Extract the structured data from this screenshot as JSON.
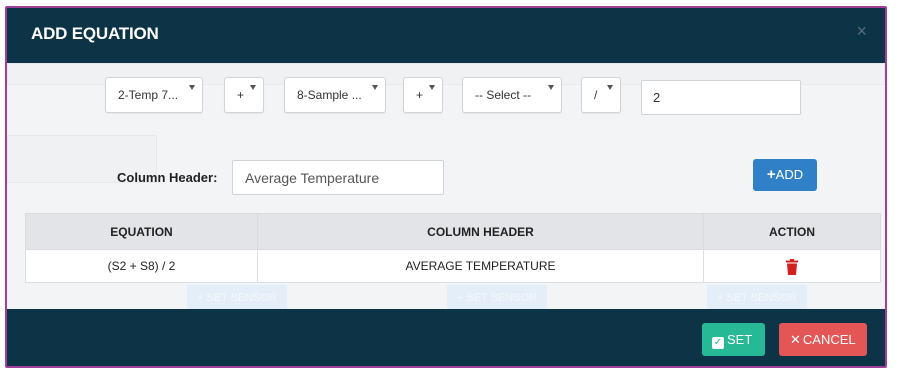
{
  "modal": {
    "title": "ADD EQUATION",
    "close_icon": "×"
  },
  "equation_builder": {
    "sensor_1": "2-Temp 7...",
    "operator_1": "+",
    "sensor_2": "8-Sample ...",
    "operator_2": "+",
    "sensor_3": "-- Select --",
    "operator_3": "/",
    "value": "2"
  },
  "column_header": {
    "label": "Column Header:",
    "value": "Average Temperature"
  },
  "add_button": {
    "icon": "+",
    "label": "ADD"
  },
  "table": {
    "headers": [
      "EQUATION",
      "COLUMN HEADER",
      "ACTION"
    ],
    "rows": [
      {
        "equation": "(S2 + S8) / 2",
        "column_header": "AVERAGE TEMPERATURE",
        "action_icon": "trash-icon"
      }
    ]
  },
  "background_buttons": [
    "+ SET SENSOR",
    "+ SET SENSOR",
    "+ SET SENSOR"
  ],
  "footer": {
    "set_label": "SET",
    "cancel_label": "CANCEL"
  },
  "colors": {
    "header_bg": "#0d3346",
    "border_accent": "#a0409a",
    "add_button": "#2f80c7",
    "set_button": "#27b996",
    "cancel_button": "#e45555",
    "trash_icon": "#d0211c"
  }
}
